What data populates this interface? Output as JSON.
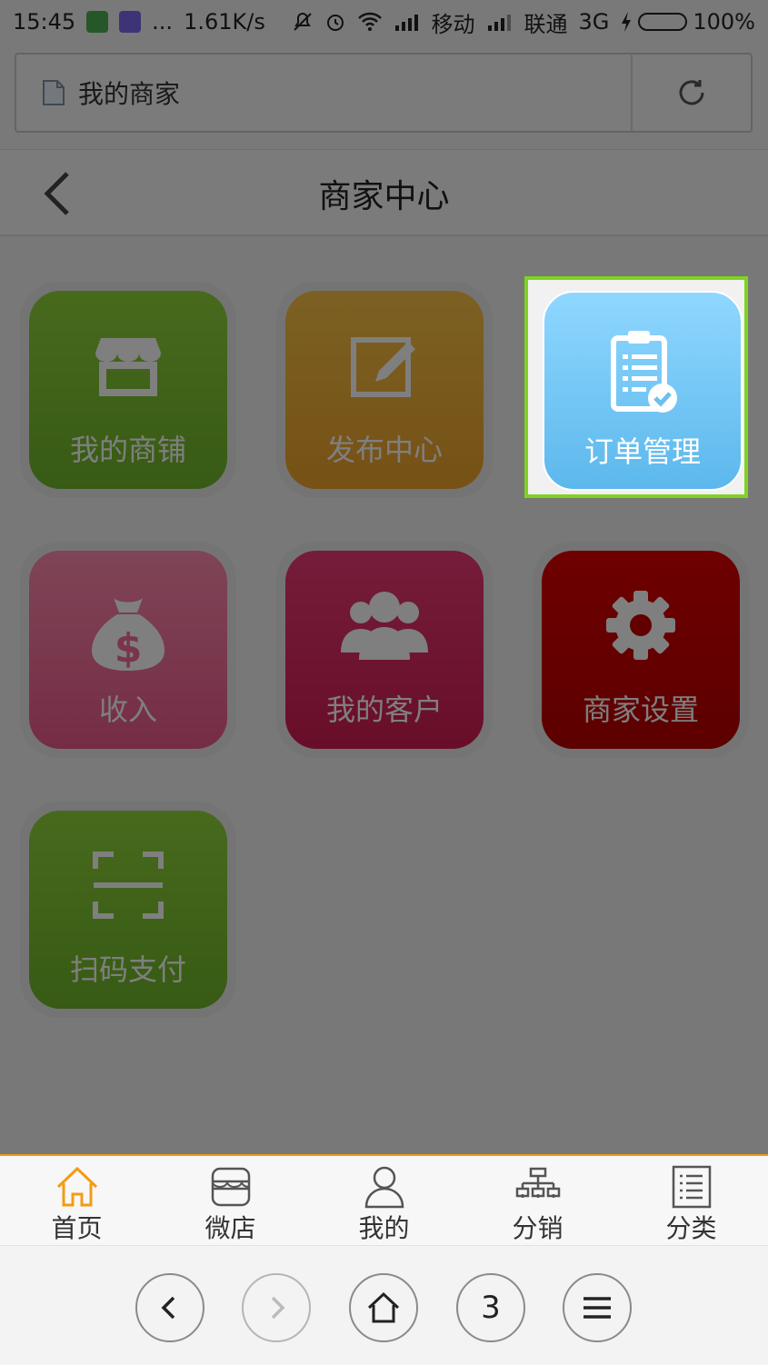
{
  "status_bar": {
    "time": "15:45",
    "dots": "...",
    "speed": "1.61K/s",
    "carrier1": "移动",
    "carrier2": "联通",
    "network": "3G",
    "battery": "100%"
  },
  "url_bar": {
    "title": "我的商家"
  },
  "header": {
    "title": "商家中心"
  },
  "tiles": [
    {
      "label": "我的商铺",
      "icon": "store-icon",
      "color": "#7fc332"
    },
    {
      "label": "发布中心",
      "icon": "edit-icon",
      "color": "#f4b33c"
    },
    {
      "label": "订单管理",
      "icon": "clipboard-check-icon",
      "color": "#6fc6f5"
    },
    {
      "label": "收入",
      "icon": "money-bag-icon",
      "color": "#f47099"
    },
    {
      "label": "我的客户",
      "icon": "users-icon",
      "color": "#e0306a"
    },
    {
      "label": "商家设置",
      "icon": "gear-icon",
      "color": "#cc0000"
    },
    {
      "label": "扫码支付",
      "icon": "scan-icon",
      "color": "#7fc332"
    }
  ],
  "bottom_nav": [
    {
      "label": "首页",
      "icon": "home-icon"
    },
    {
      "label": "微店",
      "icon": "shop-icon"
    },
    {
      "label": "我的",
      "icon": "user-icon"
    },
    {
      "label": "分销",
      "icon": "network-icon"
    },
    {
      "label": "分类",
      "icon": "list-icon"
    }
  ],
  "browser_toolbar": {
    "tab_count": "3"
  },
  "colors": {
    "highlight": "#7ed321",
    "nav_accent": "#f39c12"
  }
}
